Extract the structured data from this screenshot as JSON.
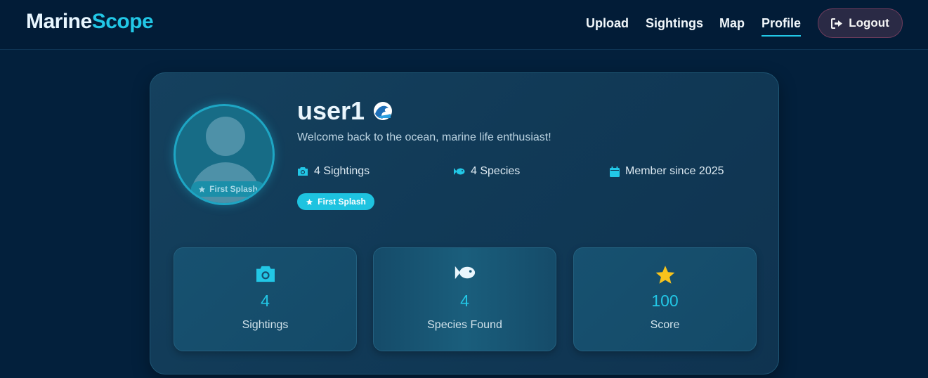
{
  "brand": {
    "part1": "Marine",
    "part2": "Scope"
  },
  "nav": {
    "upload": "Upload",
    "sightings": "Sightings",
    "map": "Map",
    "profile": "Profile",
    "logout": "Logout"
  },
  "profile": {
    "username": "user1",
    "welcome": "Welcome back to the ocean, marine life enthusiast!",
    "meta": {
      "sightings": "4 Sightings",
      "species": "4 Species",
      "member": "Member since 2025"
    },
    "badge": "First Splash",
    "avatar_badge": "First Splash"
  },
  "stats": [
    {
      "icon": "camera-icon",
      "value": "4",
      "label": "Sightings"
    },
    {
      "icon": "fish-icon",
      "value": "4",
      "label": "Species Found"
    },
    {
      "icon": "star-icon",
      "value": "100",
      "label": "Score"
    }
  ],
  "colors": {
    "accent": "#22c7e6",
    "background": "#03203c",
    "star": "#f7c31c"
  }
}
